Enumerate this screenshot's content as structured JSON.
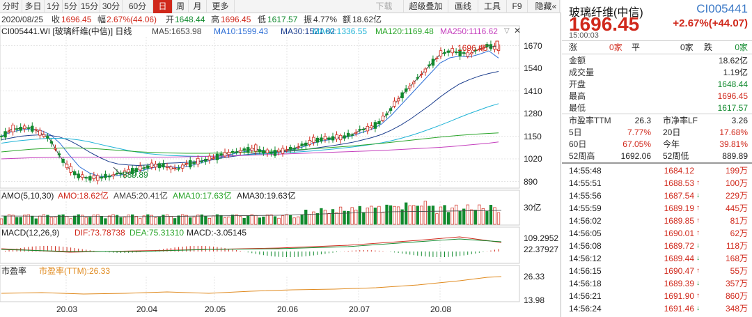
{
  "toolbar": {
    "items": [
      "分时",
      "多日",
      "1分",
      "5分",
      "15分",
      "30分",
      "60分",
      "日",
      "周",
      "月",
      "更多"
    ],
    "active": "日",
    "right_items": [
      {
        "label": "下载",
        "disabled": true
      },
      {
        "label": "超级叠加",
        "disabled": false
      },
      {
        "label": "画线",
        "disabled": false
      },
      {
        "label": "工具",
        "disabled": false
      },
      {
        "label": "F9",
        "disabled": false
      },
      {
        "label": "隐藏",
        "disabled": false
      }
    ],
    "scroll_icon": "double-chevron-left-icon"
  },
  "info": {
    "date": "2020/08/25",
    "close_label": "收",
    "close": "1696.45",
    "amp_label": "幅",
    "amp": "2.67%(44.06)",
    "open_label": "开",
    "open": "1648.44",
    "high_label": "高",
    "high": "1696.45",
    "low_label": "低",
    "low": "1617.57",
    "swing_label": "振",
    "swing": "4.77%",
    "amt_label": "额",
    "amt": "18.62亿"
  },
  "main_legend": {
    "title": "CI005441.WI [玻璃纤维(中信)] 日线",
    "ma5": "MA5:1653.98",
    "ma10": "MA10:1599.43",
    "ma30": "MA30:1521.82",
    "ma60": "MA60:1336.55",
    "ma120": "MA120:1169.48",
    "ma250": "MA250:1116.62"
  },
  "main_marks": {
    "high": "1696.45",
    "low": "889.89"
  },
  "vol_legend": {
    "title": "AMO(5,10,30)",
    "amo": "AMO:18.62亿",
    "ma5": "AMA5:20.41亿",
    "ma10": "AMA10:17.63亿",
    "ma30": "AMA30:19.63亿",
    "axis": "30亿"
  },
  "macd_legend": {
    "title": "MACD(12,26,9)",
    "dif": "DIF:73.78738",
    "dea": "DEA:75.31310",
    "macd": "MACD:-3.05145",
    "axis_top": "109.2952",
    "axis_mid": "22.37927"
  },
  "pe_legend": {
    "title": "市盈率",
    "series": "市盈率(TTM):26.33",
    "axis_top": "26.33",
    "axis_bottom": "13.98"
  },
  "colors": {
    "up": "#d0281b",
    "down": "#118a2e",
    "ma5": "#444444",
    "ma10": "#2e6fd6",
    "ma30": "#1a3c8c",
    "ma60": "#1fb3d6",
    "ma120": "#2aa52a",
    "ma250": "#c43fbd"
  },
  "chart_data": {
    "type": "line",
    "x_ticks": [
      "20.03",
      "20.04",
      "20.05",
      "20.06",
      "20.07",
      "20.08"
    ],
    "y_ticks": [
      1670,
      1540,
      1410,
      1280,
      1150,
      1020,
      890
    ],
    "ylim": [
      860,
      1720
    ],
    "grid": true,
    "series": [
      {
        "name": "MA5",
        "values": [
          1145,
          1190,
          1195,
          1200,
          1170,
          1130,
          1035,
          960,
          920,
          910,
          912,
          920,
          935,
          945,
          960,
          975,
          985,
          975,
          960,
          990,
          1000,
          1015,
          1030,
          1050,
          1060,
          1070,
          1080,
          1060,
          1055,
          1070,
          1080,
          1100,
          1125,
          1135,
          1140,
          1145,
          1160,
          1190,
          1200,
          1240,
          1310,
          1380,
          1440,
          1500,
          1560,
          1620,
          1640,
          1630,
          1620,
          1650,
          1670,
          1654
        ]
      },
      {
        "name": "MA10",
        "values": [
          1150,
          1175,
          1185,
          1192,
          1185,
          1160,
          1110,
          1040,
          975,
          940,
          920,
          918,
          925,
          935,
          948,
          962,
          975,
          978,
          970,
          975,
          990,
          1005,
          1020,
          1038,
          1052,
          1062,
          1072,
          1068,
          1062,
          1066,
          1074,
          1090,
          1110,
          1124,
          1133,
          1140,
          1152,
          1172,
          1190,
          1220,
          1270,
          1330,
          1390,
          1450,
          1510,
          1570,
          1600,
          1610,
          1605,
          1620,
          1640,
          1599
        ]
      },
      {
        "name": "MA30",
        "values": [
          1130,
          1140,
          1150,
          1155,
          1158,
          1155,
          1145,
          1125,
          1095,
          1060,
          1030,
          1005,
          990,
          985,
          982,
          985,
          990,
          995,
          997,
          1000,
          1005,
          1012,
          1020,
          1028,
          1036,
          1044,
          1050,
          1055,
          1058,
          1062,
          1066,
          1072,
          1080,
          1088,
          1096,
          1105,
          1115,
          1128,
          1142,
          1160,
          1185,
          1215,
          1250,
          1290,
          1330,
          1375,
          1415,
          1450,
          1475,
          1495,
          1510,
          1522
        ]
      },
      {
        "name": "MA60",
        "values": [
          1110,
          1118,
          1125,
          1130,
          1135,
          1138,
          1138,
          1135,
          1128,
          1118,
          1105,
          1092,
          1080,
          1068,
          1058,
          1050,
          1045,
          1040,
          1038,
          1036,
          1035,
          1035,
          1036,
          1038,
          1040,
          1043,
          1046,
          1049,
          1052,
          1055,
          1058,
          1062,
          1066,
          1071,
          1076,
          1082,
          1088,
          1095,
          1103,
          1112,
          1124,
          1138,
          1154,
          1172,
          1192,
          1213,
          1235,
          1258,
          1280,
          1300,
          1320,
          1337
        ]
      },
      {
        "name": "MA120",
        "values": [
          1060,
          1065,
          1070,
          1075,
          1078,
          1080,
          1082,
          1083,
          1082,
          1080,
          1077,
          1073,
          1069,
          1065,
          1061,
          1058,
          1056,
          1054,
          1053,
          1052,
          1052,
          1052,
          1053,
          1054,
          1056,
          1058,
          1060,
          1062,
          1065,
          1068,
          1071,
          1074,
          1078,
          1082,
          1086,
          1090,
          1094,
          1099,
          1104,
          1109,
          1115,
          1121,
          1127,
          1133,
          1139,
          1145,
          1150,
          1155,
          1159,
          1163,
          1166,
          1169
        ]
      },
      {
        "name": "MA250",
        "values": [
          1020,
          1022,
          1024,
          1026,
          1027,
          1028,
          1029,
          1030,
          1030,
          1030,
          1030,
          1030,
          1030,
          1030,
          1030,
          1030,
          1030,
          1030,
          1031,
          1032,
          1033,
          1034,
          1035,
          1036,
          1038,
          1040,
          1042,
          1044,
          1046,
          1048,
          1050,
          1052,
          1054,
          1056,
          1058,
          1060,
          1062,
          1064,
          1066,
          1068,
          1071,
          1074,
          1077,
          1080,
          1083,
          1086,
          1090,
          1095,
          1100,
          1105,
          1110,
          1117
        ]
      }
    ]
  },
  "quote": {
    "name": "玻璃纤维(中信)",
    "code": "CI005441",
    "price": "1696.45",
    "change": "+2.67%(+44.07)",
    "time": "15:00:03",
    "limit_row": {
      "up_label": "涨",
      "up": "0家",
      "flat_label": "平",
      "flat": "0家",
      "down_label": "跌",
      "down": "0家"
    },
    "rows": [
      {
        "k": "金额",
        "v": "18.62亿",
        "c": "dark"
      },
      {
        "k": "成交量",
        "v": "1.19亿",
        "c": "dark"
      },
      {
        "k": "开盘",
        "v": "1648.44",
        "c": "green"
      },
      {
        "k": "最高",
        "v": "1696.45",
        "c": "red"
      },
      {
        "k": "最低",
        "v": "1617.57",
        "c": "green"
      }
    ],
    "stats": [
      {
        "k1": "市盈率TTM",
        "v1": "26.3",
        "c1": "dark",
        "k2": "市净率LF",
        "v2": "3.26",
        "c2": "dark"
      },
      {
        "k1": "5日",
        "v1": "7.77%",
        "c1": "red",
        "k2": "20日",
        "v2": "17.68%",
        "c2": "red"
      },
      {
        "k1": "60日",
        "v1": "67.05%",
        "c1": "red",
        "k2": "今年",
        "v2": "39.81%",
        "c2": "red"
      },
      {
        "k1": "52周高",
        "v1": "1692.06",
        "c1": "dark",
        "k2": "52周低",
        "v2": "889.89",
        "c2": "dark"
      }
    ],
    "ticks": [
      {
        "t": "14:55:48",
        "p": "1684.12",
        "dir": "",
        "vol": "199万"
      },
      {
        "t": "14:55:51",
        "p": "1688.53",
        "dir": "up",
        "vol": "100万"
      },
      {
        "t": "14:55:56",
        "p": "1687.54",
        "dir": "down",
        "vol": "229万"
      },
      {
        "t": "14:55:59",
        "p": "1689.19",
        "dir": "up",
        "vol": "445万"
      },
      {
        "t": "14:56:02",
        "p": "1689.85",
        "dir": "up",
        "vol": "81万"
      },
      {
        "t": "14:56:05",
        "p": "1690.01",
        "dir": "up",
        "vol": "62万"
      },
      {
        "t": "14:56:08",
        "p": "1689.72",
        "dir": "down",
        "vol": "118万"
      },
      {
        "t": "14:56:12",
        "p": "1689.44",
        "dir": "down",
        "vol": "168万"
      },
      {
        "t": "14:56:15",
        "p": "1690.47",
        "dir": "up",
        "vol": "55万"
      },
      {
        "t": "14:56:18",
        "p": "1689.39",
        "dir": "down",
        "vol": "357万"
      },
      {
        "t": "14:56:21",
        "p": "1691.90",
        "dir": "up",
        "vol": "860万"
      },
      {
        "t": "14:56:24",
        "p": "1691.46",
        "dir": "down",
        "vol": "348万"
      }
    ]
  }
}
